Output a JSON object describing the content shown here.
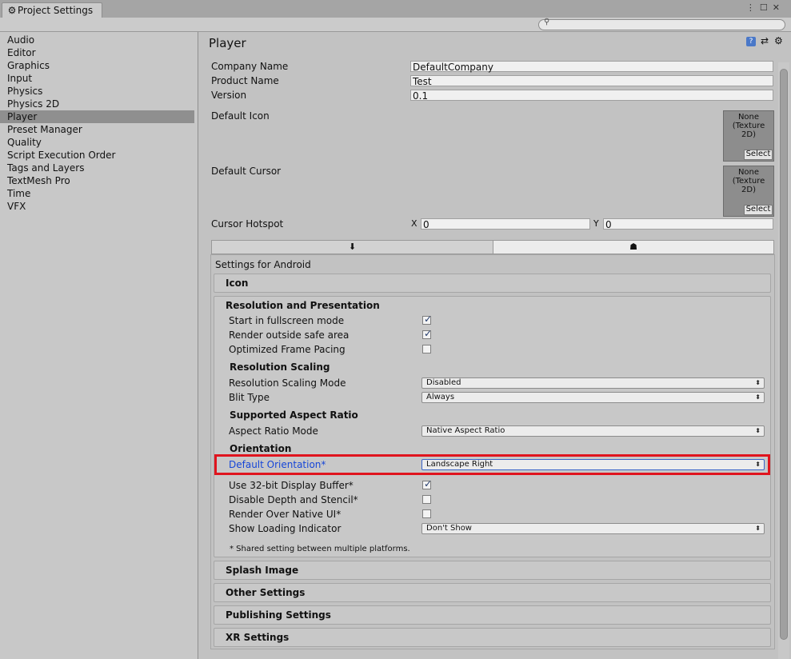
{
  "window": {
    "tab_title": "Project Settings",
    "controls": "⋮☐✕"
  },
  "sidebar": {
    "items": [
      "Audio",
      "Editor",
      "Graphics",
      "Input",
      "Physics",
      "Physics 2D",
      "Player",
      "Preset Manager",
      "Quality",
      "Script Execution Order",
      "Tags and Layers",
      "TextMesh Pro",
      "Time",
      "VFX"
    ],
    "selected": "Player"
  },
  "player": {
    "title": "Player",
    "company_label": "Company Name",
    "company_value": "DefaultCompany",
    "product_label": "Product Name",
    "product_value": "Test",
    "version_label": "Version",
    "version_value": "0.1",
    "default_icon_label": "Default Icon",
    "default_cursor_label": "Default Cursor",
    "texture_none": "None",
    "texture_type": "(Texture",
    "texture_type2": "2D)",
    "select_label": "Select",
    "cursor_hotspot_label": "Cursor Hotspot",
    "hotspot_x_label": "X",
    "hotspot_x": "0",
    "hotspot_y_label": "Y",
    "hotspot_y": "0"
  },
  "platform": {
    "settings_for": "Settings for Android",
    "icon_section": "Icon",
    "resolution_section": "Resolution and Presentation",
    "fullscreen_label": "Start in fullscreen mode",
    "fullscreen": true,
    "safe_area_label": "Render outside safe area",
    "safe_area": true,
    "frame_pacing_label": "Optimized Frame Pacing",
    "frame_pacing": false,
    "resolution_scaling_header": "Resolution Scaling",
    "scaling_mode_label": "Resolution Scaling Mode",
    "scaling_mode_value": "Disabled",
    "blit_type_label": "Blit Type",
    "blit_type_value": "Always",
    "aspect_header": "Supported Aspect Ratio",
    "aspect_mode_label": "Aspect Ratio Mode",
    "aspect_mode_value": "Native Aspect Ratio",
    "orientation_header": "Orientation",
    "default_orientation_label": "Default Orientation*",
    "default_orientation_value": "Landscape Right",
    "display_buffer_label": "Use 32-bit Display Buffer*",
    "display_buffer": true,
    "depth_stencil_label": "Disable Depth and Stencil*",
    "depth_stencil": false,
    "render_native_label": "Render Over Native UI*",
    "render_native": false,
    "loading_indicator_label": "Show Loading Indicator",
    "loading_indicator_value": "Don't Show",
    "shared_note": "* Shared setting between multiple platforms.",
    "splash_section": "Splash Image",
    "other_section": "Other Settings",
    "publishing_section": "Publishing Settings",
    "xr_section": "XR Settings"
  },
  "colors": {
    "highlight": "#e0141e",
    "label_blue": "#1646d8"
  },
  "icons": [
    "gear-icon",
    "search-icon",
    "help-icon",
    "preset-icon",
    "settings-gear-icon",
    "download-icon",
    "android-icon",
    "checkmark-icon",
    "dropdown-arrow-icon"
  ]
}
